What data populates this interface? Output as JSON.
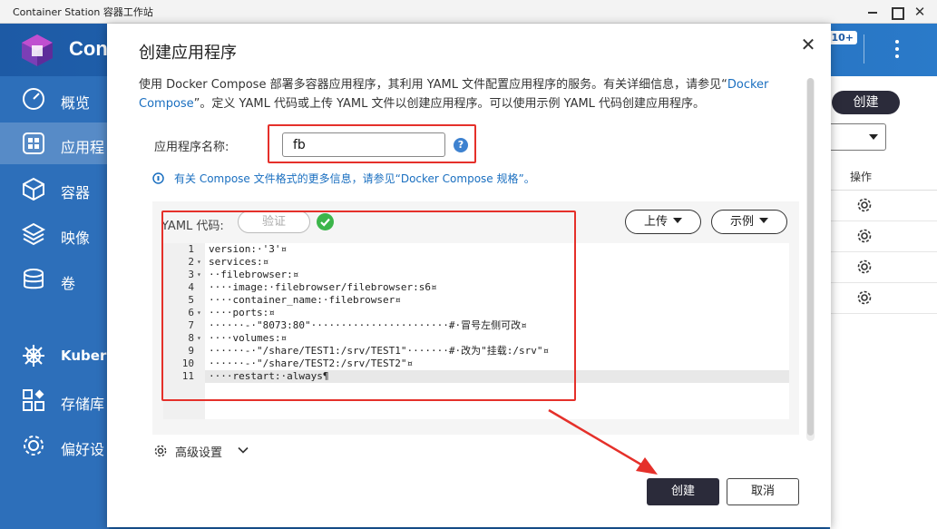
{
  "window": {
    "title": "Container Station 容器工作站"
  },
  "topbar": {
    "brand": "Con",
    "badge": "10+"
  },
  "sidebar": {
    "items": [
      {
        "label": "概览",
        "icon": "gauge-icon"
      },
      {
        "label": "应用程",
        "icon": "apps-grid-icon"
      },
      {
        "label": "容器",
        "icon": "cube-icon"
      },
      {
        "label": "映像",
        "icon": "layers-icon"
      },
      {
        "label": "卷",
        "icon": "database-icon"
      },
      {
        "label": "Kubern",
        "icon": "helm-icon"
      },
      {
        "label": "存储库",
        "icon": "registry-icon"
      },
      {
        "label": "偏好设",
        "icon": "gear-icon"
      }
    ]
  },
  "content": {
    "create_label": "创建",
    "ops_header": "操作"
  },
  "dialog": {
    "title": "创建应用程序",
    "desc_part1": "使用 Docker Compose 部署多容器应用程序，其利用 YAML 文件配置应用程序的服务。有关详细信息，请参见“",
    "desc_link": "Docker Compose",
    "desc_part2": "”。定义 YAML 代码或上传 YAML 文件以创建应用程序。可以使用示例 YAML 代码创建应用程序。",
    "name_label": "应用程序名称:",
    "name_value": "fb",
    "info_text": "有关 Compose 文件格式的更多信息，请参见“Docker Compose 规格”。",
    "yaml_label": "YAML 代码:",
    "verify_label": "验证",
    "upload_label": "上传",
    "example_label": "示例",
    "advanced_label": "高级设置",
    "create_label": "创建",
    "cancel_label": "取消"
  },
  "editor": {
    "lines": [
      {
        "n": "1",
        "fold": "",
        "code": "version:·'3'¤"
      },
      {
        "n": "2",
        "fold": "▾",
        "code": "services:¤"
      },
      {
        "n": "3",
        "fold": "▾",
        "code": "··filebrowser:¤"
      },
      {
        "n": "4",
        "fold": "",
        "code": "····image:·filebrowser/filebrowser:s6¤"
      },
      {
        "n": "5",
        "fold": "",
        "code": "····container_name:·filebrowser¤"
      },
      {
        "n": "6",
        "fold": "▾",
        "code": "····ports:¤"
      },
      {
        "n": "7",
        "fold": "",
        "code": "······-·\"8073:80\"·······················#·冒号左侧可改¤"
      },
      {
        "n": "8",
        "fold": "▾",
        "code": "····volumes:¤"
      },
      {
        "n": "9",
        "fold": "",
        "code": "······-·\"/share/TEST1:/srv/TEST1\"·······#·改为\"挂载:/srv\"¤"
      },
      {
        "n": "10",
        "fold": "",
        "code": "······-·\"/share/TEST2:/srv/TEST2\"¤"
      },
      {
        "n": "11",
        "fold": "",
        "code": "····restart:·always¶"
      }
    ]
  },
  "colors": {
    "accent": "#2b2b3a",
    "link": "#1a6fc0",
    "highlight": "#e5302a",
    "sidebar": "#2d6fba"
  }
}
